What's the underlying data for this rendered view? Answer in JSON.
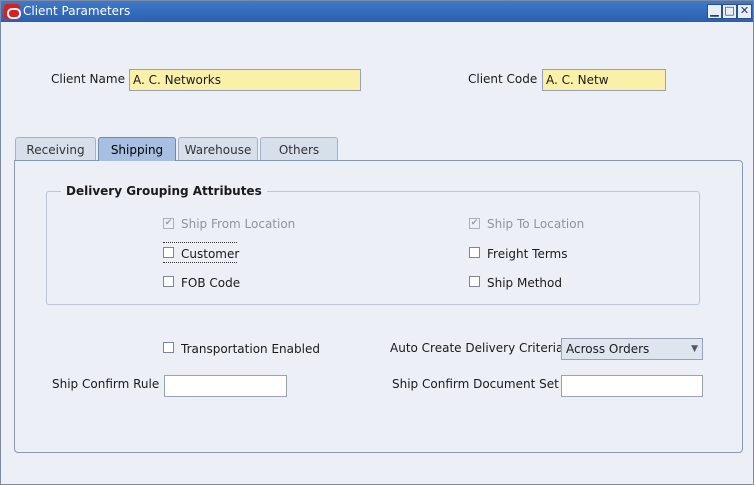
{
  "window": {
    "title": "Client Parameters",
    "controls": {
      "minimize": "▁",
      "maximize": "□",
      "close": "✕"
    }
  },
  "header": {
    "client_name_label": "Client Name",
    "client_name_value": "A. C. Networks",
    "client_code_label": "Client Code",
    "client_code_value": "A. C. Netw"
  },
  "tabs": [
    {
      "label": "Receiving",
      "active": false
    },
    {
      "label": "Shipping",
      "active": true
    },
    {
      "label": "Warehouse",
      "active": false
    },
    {
      "label": "Others",
      "active": false
    }
  ],
  "delivery_grouping": {
    "title": "Delivery Grouping Attributes",
    "items": [
      {
        "label": "Ship From Location",
        "checked": true,
        "disabled": true
      },
      {
        "label": "Ship To Location",
        "checked": true,
        "disabled": true
      },
      {
        "label": "Customer",
        "checked": false,
        "disabled": false
      },
      {
        "label": "Freight Terms",
        "checked": false,
        "disabled": false
      },
      {
        "label": "FOB Code",
        "checked": false,
        "disabled": false
      },
      {
        "label": "Ship Method",
        "checked": false,
        "disabled": false
      }
    ]
  },
  "shipping": {
    "transportation_enabled_label": "Transportation Enabled",
    "transportation_enabled": false,
    "auto_create_label": "Auto Create Delivery Criteria",
    "auto_create_value": "Across Orders",
    "ship_confirm_rule_label": "Ship Confirm Rule",
    "ship_confirm_rule_value": "",
    "ship_confirm_doc_set_label": "Ship Confirm Document Set",
    "ship_confirm_doc_set_value": ""
  },
  "icons": {
    "check_glyph": "✔",
    "dropdown_glyph": "▼"
  },
  "colors": {
    "titlebar": "#2f66b5",
    "required_field": "#fbf0a9",
    "active_tab": "#a7bfe0"
  }
}
